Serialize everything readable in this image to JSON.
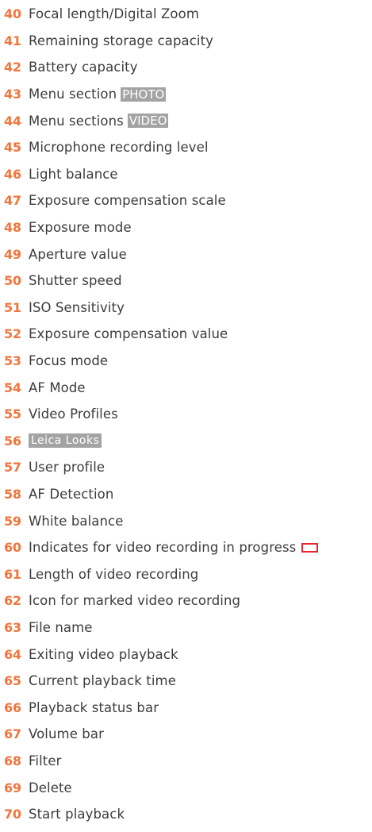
{
  "colors": {
    "number": "#f2753b",
    "text": "#3c3c3c",
    "tag_background": "#a3a3a3",
    "tag_text": "#ffffff",
    "recording_indicator": "#e4262f"
  },
  "items": [
    {
      "num": "40",
      "label": "Focal length/Digital Zoom"
    },
    {
      "num": "41",
      "label": "Remaining storage capacity"
    },
    {
      "num": "42",
      "label": "Battery capacity"
    },
    {
      "num": "43",
      "label": "Menu section",
      "tag": "PHOTO"
    },
    {
      "num": "44",
      "label": "Menu sections",
      "tag": "VIDEO"
    },
    {
      "num": "45",
      "label": "Microphone recording level"
    },
    {
      "num": "46",
      "label": "Light balance"
    },
    {
      "num": "47",
      "label": "Exposure compensation scale"
    },
    {
      "num": "48",
      "label": "Exposure mode"
    },
    {
      "num": "49",
      "label": "Aperture value"
    },
    {
      "num": "50",
      "label": "Shutter speed"
    },
    {
      "num": "51",
      "label": "ISO Sensitivity"
    },
    {
      "num": "52",
      "label": "Exposure compensation value"
    },
    {
      "num": "53",
      "label": "Focus mode"
    },
    {
      "num": "54",
      "label": "AF Mode"
    },
    {
      "num": "55",
      "label": "Video Profiles"
    },
    {
      "num": "56",
      "tag": "Leica Looks"
    },
    {
      "num": "57",
      "label": "User profile"
    },
    {
      "num": "58",
      "label": "AF Detection"
    },
    {
      "num": "59",
      "label": "White balance"
    },
    {
      "num": "60",
      "label": "Indicates for video recording in progress"
    },
    {
      "num": "61",
      "label": "Length of video recording"
    },
    {
      "num": "62",
      "label": "Icon for marked video recording"
    },
    {
      "num": "63",
      "label": "File name"
    },
    {
      "num": "64",
      "label": "Exiting video playback"
    },
    {
      "num": "65",
      "label": "Current playback time"
    },
    {
      "num": "66",
      "label": "Playback status bar"
    },
    {
      "num": "67",
      "label": "Volume bar"
    },
    {
      "num": "68",
      "label": "Filter"
    },
    {
      "num": "69",
      "label": "Delete"
    },
    {
      "num": "70",
      "label": "Start playback"
    }
  ]
}
